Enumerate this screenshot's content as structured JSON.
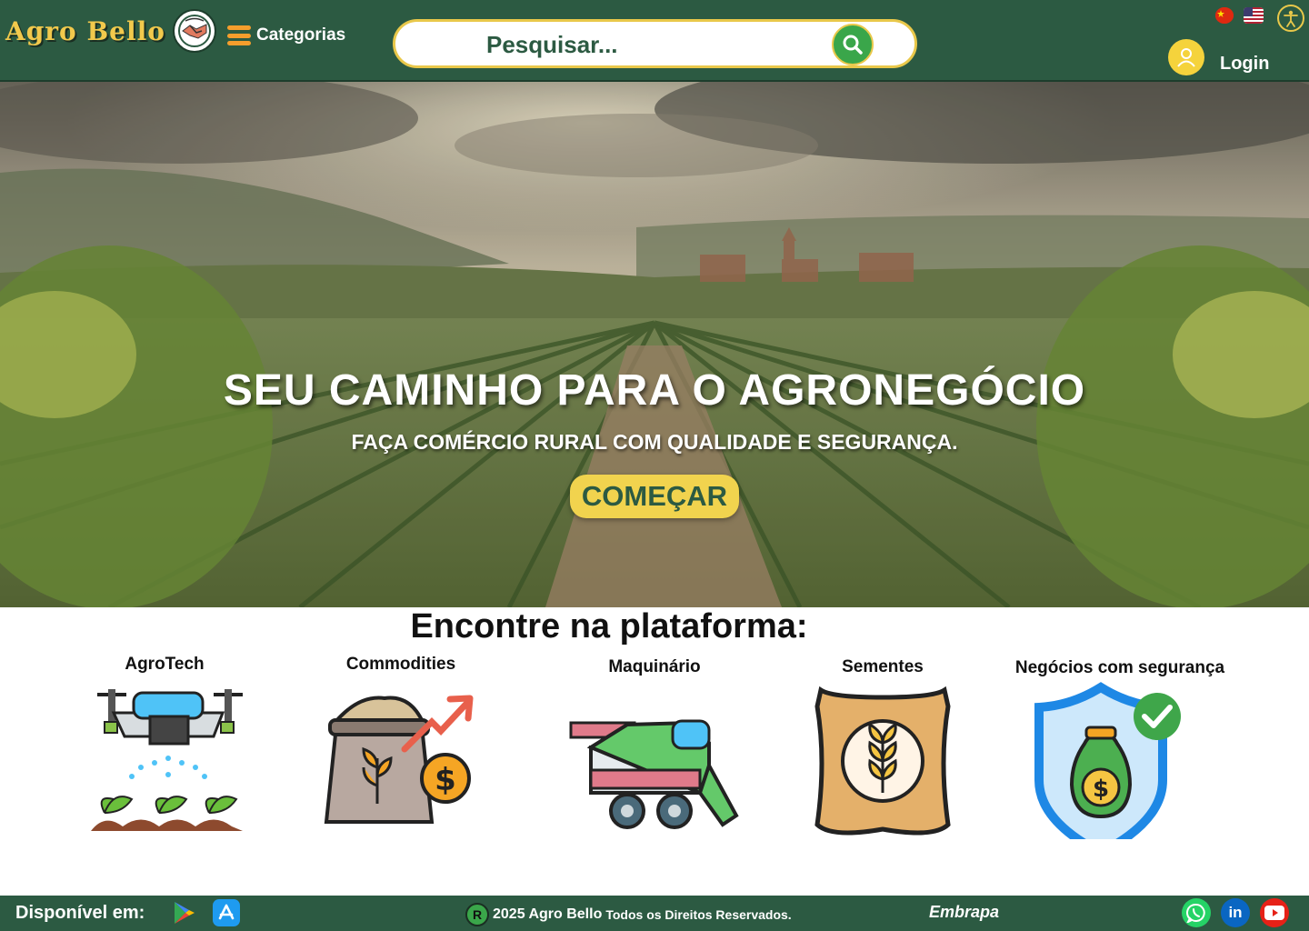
{
  "header": {
    "brand": "Agro Bello",
    "categories_label": "Categorias",
    "search_placeholder": "Pesquisar...",
    "login_label": "Login"
  },
  "hero": {
    "title": "SEU CAMINHO PARA O AGRONEGÓCIO",
    "subtitle": "FAÇA COMÉRCIO RURAL COM QUALIDADE E SEGURANÇA.",
    "cta_label": "COMEÇAR"
  },
  "features": {
    "title": "Encontre na plataforma:",
    "items": [
      {
        "label": "AgroTech",
        "icon": "drone-icon"
      },
      {
        "label": "Commodities",
        "icon": "grain-sack-chart-icon"
      },
      {
        "label": "Maquinário",
        "icon": "harvester-icon"
      },
      {
        "label": "Sementes",
        "icon": "seed-bag-icon"
      },
      {
        "label": "Negócios com segurança",
        "icon": "shield-money-icon"
      }
    ]
  },
  "footer": {
    "available_label": "Disponível em:",
    "reg_symbol": "R",
    "copyright_year_brand": "2025 Agro Bello",
    "copyright_rest": "Todos os Direitos Reservados.",
    "partner": "Embrapa"
  },
  "colors": {
    "header_bg": "#2c5a42",
    "accent_yellow": "#f1d34e",
    "search_green": "#3aa64a"
  }
}
